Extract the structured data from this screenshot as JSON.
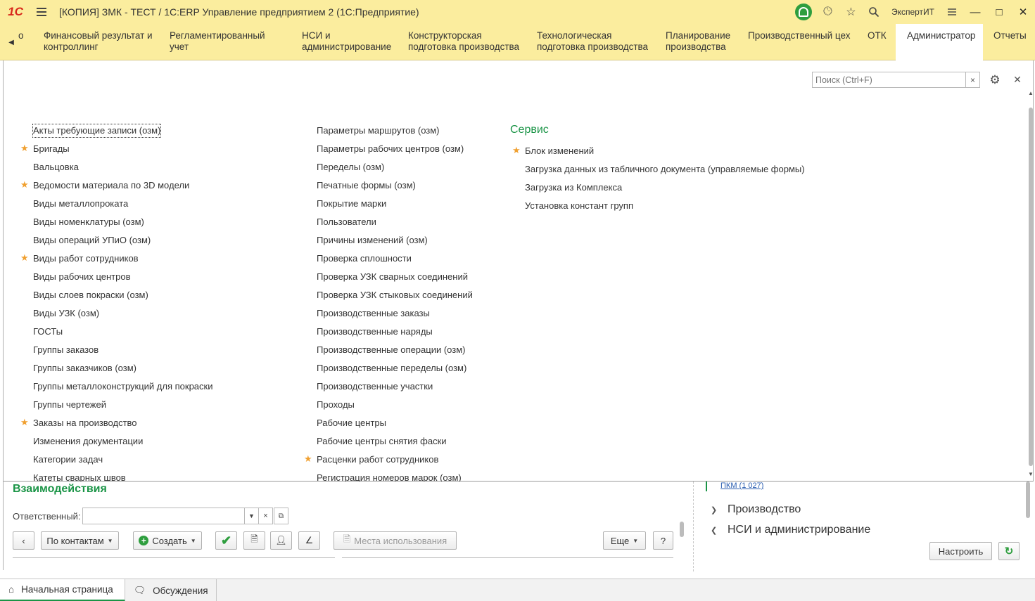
{
  "titlebar": {
    "logo": "1С",
    "title": "[КОПИЯ] ЗМК - ТЕСТ / 1С:ERP Управление предприятием 2  (1С:Предприятие)",
    "user": "ЭкспертИТ"
  },
  "sections": {
    "partial_label": "о",
    "items": [
      {
        "label1": "Финансовый результат и",
        "label2": "контроллинг"
      },
      {
        "label1": "Регламентированный учет",
        "label2": ""
      },
      {
        "label1": "НСИ и",
        "label2": "администрирование"
      },
      {
        "label1": "Конструкторская",
        "label2": "подготовка производства"
      },
      {
        "label1": "Технологическая",
        "label2": "подготовка производства"
      },
      {
        "label1": "Планирование",
        "label2": "производства"
      },
      {
        "label1": "Производственный цех",
        "label2": ""
      },
      {
        "label1": "ОТК",
        "label2": ""
      },
      {
        "label1": "Администратор",
        "label2": ""
      },
      {
        "label1": "Отчеты",
        "label2": ""
      }
    ],
    "active_index": 8
  },
  "search": {
    "placeholder": "Поиск (Ctrl+F)"
  },
  "column1": [
    {
      "label": "Акты требующие записи (озм)",
      "starred": false
    },
    {
      "label": "Бригады",
      "starred": true
    },
    {
      "label": "Вальцовка",
      "starred": false
    },
    {
      "label": "Ведомости материала по 3D модели",
      "starred": true
    },
    {
      "label": "Виды металлопроката",
      "starred": false
    },
    {
      "label": "Виды номенклатуры (озм)",
      "starred": false
    },
    {
      "label": "Виды операций УПиО (озм)",
      "starred": false
    },
    {
      "label": "Виды работ сотрудников",
      "starred": true
    },
    {
      "label": "Виды рабочих центров",
      "starred": false
    },
    {
      "label": "Виды слоев покраски (озм)",
      "starred": false
    },
    {
      "label": "Виды УЗК (озм)",
      "starred": false
    },
    {
      "label": "ГОСТы",
      "starred": false
    },
    {
      "label": "Группы заказов",
      "starred": false
    },
    {
      "label": "Группы заказчиков (озм)",
      "starred": false
    },
    {
      "label": "Группы металлоконструкций для покраски",
      "starred": false
    },
    {
      "label": "Группы чертежей",
      "starred": false
    },
    {
      "label": "Заказы на производство",
      "starred": true
    },
    {
      "label": "Изменения документации",
      "starred": false
    },
    {
      "label": "Категории задач",
      "starred": false
    },
    {
      "label": "Катеты сварных швов",
      "starred": false
    }
  ],
  "column2": [
    {
      "label": "Параметры маршрутов (озм)",
      "starred": false
    },
    {
      "label": "Параметры рабочих центров (озм)",
      "starred": false
    },
    {
      "label": "Переделы (озм)",
      "starred": false
    },
    {
      "label": "Печатные формы (озм)",
      "starred": false
    },
    {
      "label": "Покрытие марки",
      "starred": false
    },
    {
      "label": "Пользователи",
      "starred": false
    },
    {
      "label": "Причины изменений (озм)",
      "starred": false
    },
    {
      "label": "Проверка сплошности",
      "starred": false
    },
    {
      "label": "Проверка УЗК сварных соединений",
      "starred": false
    },
    {
      "label": "Проверка УЗК стыковых соединений",
      "starred": false
    },
    {
      "label": "Производственные заказы",
      "starred": false
    },
    {
      "label": "Производственные наряды",
      "starred": false
    },
    {
      "label": "Производственные операции (озм)",
      "starred": false
    },
    {
      "label": "Производственные переделы (озм)",
      "starred": false
    },
    {
      "label": "Производственные участки",
      "starred": false
    },
    {
      "label": "Проходы",
      "starred": false
    },
    {
      "label": "Рабочие центры",
      "starred": false
    },
    {
      "label": "Рабочие центры снятия фаски",
      "starred": false
    },
    {
      "label": "Расценки работ сотрудников",
      "starred": true
    },
    {
      "label": "Регистрация номеров марок (озм)",
      "starred": false
    }
  ],
  "service": {
    "title": "Сервис",
    "items": [
      {
        "label": "Блок изменений",
        "starred": true
      },
      {
        "label": "Загрузка данных из табличного документа (управляемые формы)",
        "starred": false
      },
      {
        "label": "Загрузка из Комплекса",
        "starred": false
      },
      {
        "label": "Установка констант групп",
        "starred": false
      }
    ]
  },
  "interactions": {
    "title": "Взаимодействия",
    "responsible_label": "Ответственный:",
    "responsible_value": "",
    "by_contacts": "По контактам",
    "create": "Создать",
    "usage": "Места использования",
    "more": "Еще",
    "help": "?"
  },
  "right_panel": {
    "pkm": "ПКМ (1 027)",
    "tree": [
      "Производство",
      "НСИ и администрирование"
    ],
    "setup": "Настроить"
  },
  "bottom_tabs": [
    {
      "label": "Начальная страница"
    },
    {
      "label": "Обсуждения"
    }
  ],
  "colors": {
    "accent": "#1a9446",
    "star": "#f0a030",
    "chrome": "#fbed9e"
  }
}
